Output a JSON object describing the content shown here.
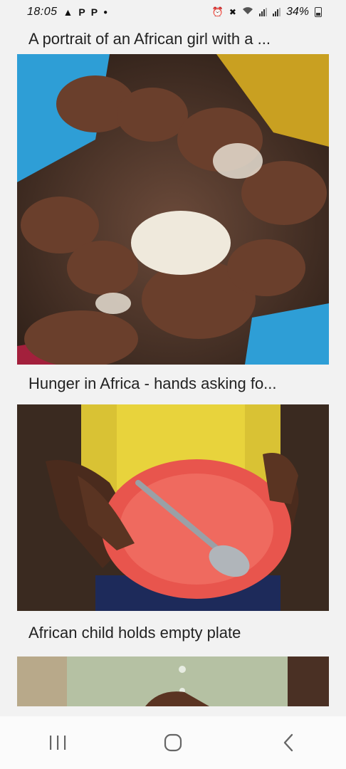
{
  "status_bar": {
    "time": "18:05",
    "left_icons": [
      "navigation-icon",
      "p-app-icon",
      "p-app-icon",
      "dot-icon"
    ],
    "battery_percent": "34%",
    "right_icons": [
      "alarm-icon",
      "mute-icon",
      "wifi-icon",
      "signal-icon",
      "signal-icon",
      "battery-icon"
    ]
  },
  "feed": {
    "items": [
      {
        "caption": "A portrait of an African girl with a ...",
        "image": "hands-with-rice-photo"
      },
      {
        "caption": "Hunger in Africa - hands asking fo...",
        "image": "child-holding-red-plate-photo"
      },
      {
        "caption": "African child holds empty plate",
        "image": "child-in-green-shirt-photo"
      }
    ]
  },
  "nav_bar": {
    "buttons": [
      "recent-apps-icon",
      "home-icon",
      "back-icon"
    ]
  },
  "colors": {
    "background": "#f2f2f2",
    "plate_red": "#e8554d",
    "shirt_blue": "#2e9ed6",
    "nav_bar": "#fbfbfb"
  }
}
